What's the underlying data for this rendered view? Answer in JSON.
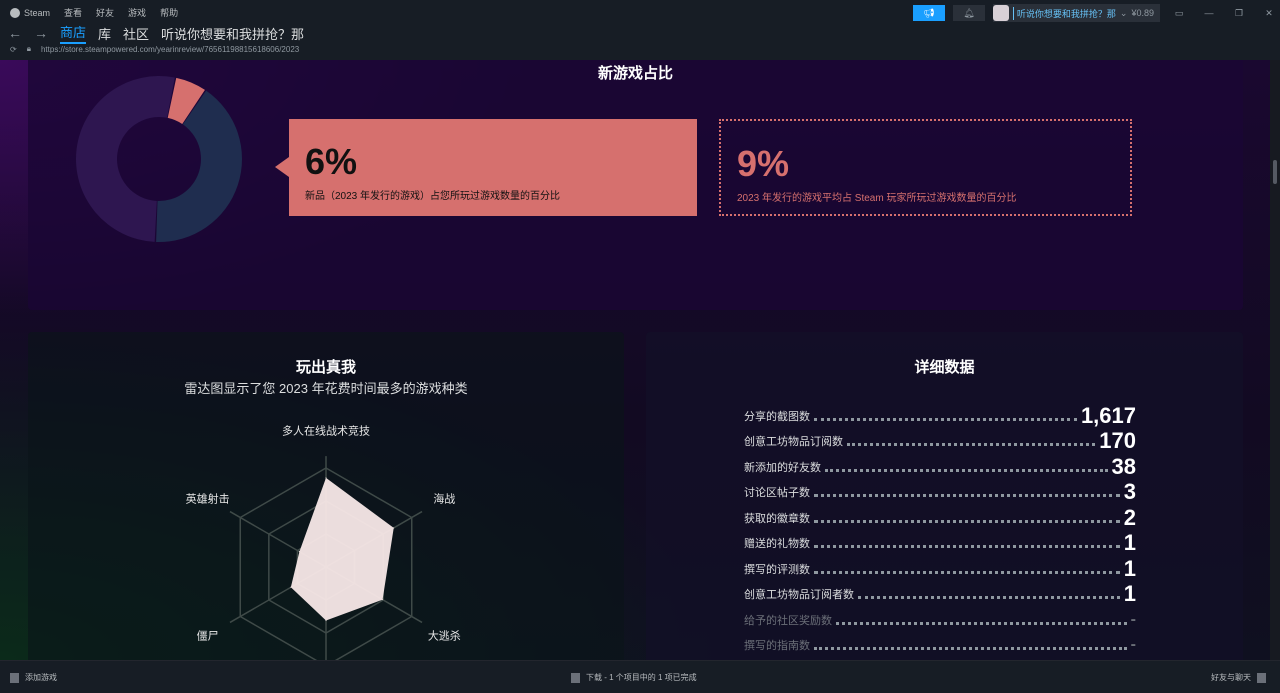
{
  "menu": {
    "app": "Steam",
    "items": [
      "查看",
      "好友",
      "游戏",
      "帮助"
    ]
  },
  "nav": {
    "tabs": [
      "商店",
      "库",
      "社区",
      "听说你想要和我拼抢？那"
    ],
    "active": 0
  },
  "url": "https://store.steampowered.com/yearinreview/76561198815618606/2023",
  "account": {
    "name": "听说你想要和我拼抢？那",
    "balance": "¥0.89"
  },
  "new_games": {
    "title": "新游戏占比",
    "your_pct": "6%",
    "your_desc": "新品（2023 年发行的游戏）占您所玩过游戏数量的百分比",
    "avg_pct": "9%",
    "avg_desc": "2023 年发行的游戏平均占 Steam 玩家所玩过游戏数量的百分比",
    "colors": {
      "new": "#d6706e",
      "other1": "#1f2d4f",
      "other2": "#2e1650"
    }
  },
  "radar": {
    "title": "玩出真我",
    "subtitle": "雷达图显示了您 2023 年花费时间最多的游戏种类"
  },
  "chart_data": {
    "type": "radar",
    "axes": [
      "多人在线战术竞技",
      "海战",
      "大逃杀",
      "",
      "僵尸",
      "英雄射击"
    ],
    "values": [
      0.9,
      0.79,
      0.66,
      0.54,
      0.41,
      0.31
    ],
    "range": [
      0,
      1
    ],
    "rings": 3,
    "fill": "#f8e8e8"
  },
  "stats": {
    "title": "详细数据",
    "rows": [
      {
        "label": "分享的截图数",
        "value": "1,617"
      },
      {
        "label": "创意工坊物品订阅数",
        "value": "170"
      },
      {
        "label": "新添加的好友数",
        "value": "38"
      },
      {
        "label": "讨论区帖子数",
        "value": "3"
      },
      {
        "label": "获取的徽章数",
        "value": "2"
      },
      {
        "label": "赠送的礼物数",
        "value": "1"
      },
      {
        "label": "撰写的评测数",
        "value": "1"
      },
      {
        "label": "创意工坊物品订阅者数",
        "value": "1"
      },
      {
        "label": "给予的社区奖励数",
        "value": "-"
      },
      {
        "label": "撰写的指南数",
        "value": "-"
      }
    ]
  },
  "footer": {
    "add_game": "添加游戏",
    "downloads": "下载 - 1 个项目中的 1 项已完成",
    "friends": "好友与聊天"
  }
}
